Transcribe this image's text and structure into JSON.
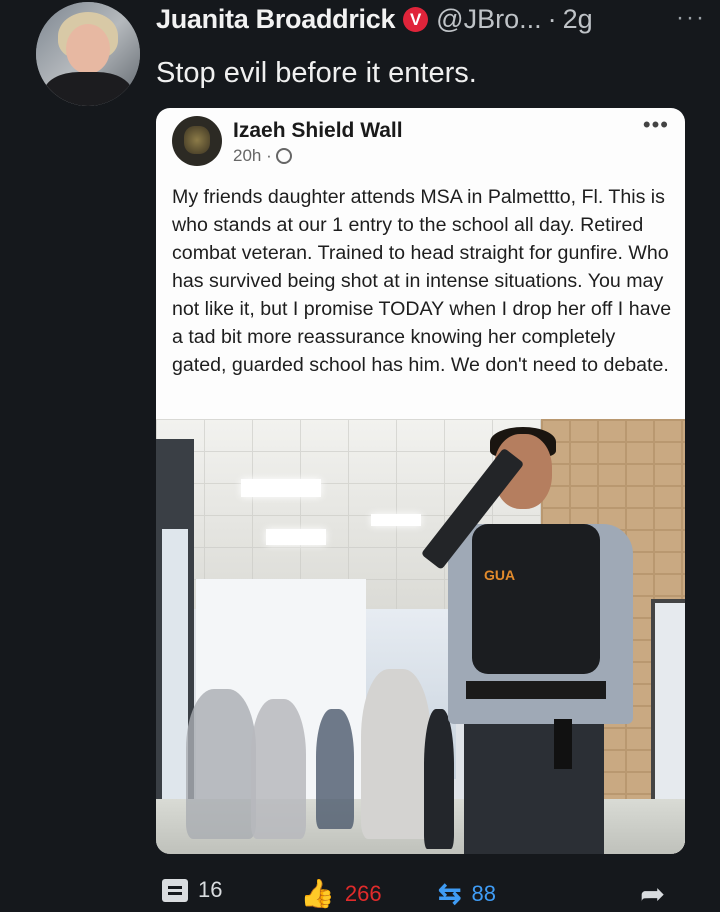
{
  "author": {
    "name": "Juanita Broaddrick",
    "verified_badge": "V",
    "handle": "@JBro...",
    "separator": "·",
    "time": "2g",
    "more": "···"
  },
  "tweet_text": "Stop evil before it enters.",
  "embedded_post": {
    "author": "Izaeh Shield Wall",
    "time": "20h ·",
    "more": "•••",
    "body": "My friends daughter attends MSA in Palmettto, Fl. This is who stands at our 1 entry to the school all day. Retired combat veteran. Trained to head straight for gunfire. Who has survived being shot at in intense situations. You may not like it, but I promise TODAY when I drop her off I have a tad bit more reassurance knowing her completely gated, guarded school has him. We don't need to debate.",
    "photo_vest_label": "GUA"
  },
  "actions": {
    "comments": "16",
    "likes": "266",
    "retweets": "88"
  },
  "colors": {
    "background": "#15181c",
    "badge": "#e0243a",
    "like": "#e02b2b",
    "retweet": "#3f9cf5"
  },
  "icons": [
    "comment-icon",
    "thumbs-up-icon",
    "retweet-icon",
    "share-icon",
    "globe-icon"
  ]
}
